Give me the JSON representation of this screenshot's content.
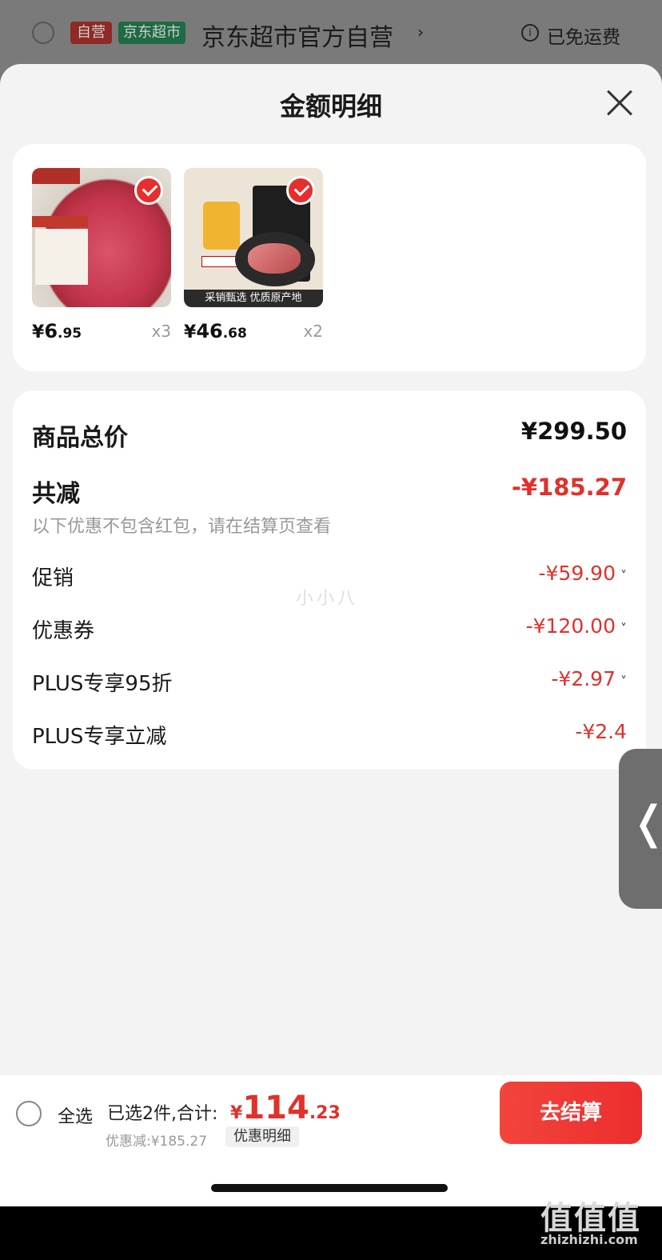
{
  "store": {
    "tag_self": "自营",
    "tag_market": "京东超市",
    "name": "京东超市官方自营",
    "chevron": "›",
    "info_icon_glyph": "i",
    "free_shipping": "已免运费"
  },
  "sheet": {
    "title": "金额明细",
    "close_icon": "close-icon"
  },
  "products": [
    {
      "yen": "¥",
      "price_int": "6",
      "price_dec": ".95",
      "qty": "x3"
    },
    {
      "yen": "¥",
      "price_int": "46",
      "price_dec": ".68",
      "qty": "x2",
      "banner": "采销甄选  优质原产地"
    }
  ],
  "summary": {
    "total_label": "商品总价",
    "total_value": "¥299.50",
    "reduce_label": "共减",
    "reduce_value": "-¥185.27",
    "note": "以下优惠不包含红包，请在结算页查看",
    "watermark": "小小八",
    "items": [
      {
        "label": "促销",
        "value": "-¥59.90",
        "expand": "˅"
      },
      {
        "label": "优惠券",
        "value": "-¥120.00",
        "expand": "˅"
      },
      {
        "label": "PLUS专享95折",
        "value": "-¥2.97",
        "expand": "˅"
      },
      {
        "label": "PLUS专享立减",
        "value": "-¥2.4"
      }
    ]
  },
  "side_handle": {
    "glyph": "❬"
  },
  "bottom": {
    "select_all": "全选",
    "selected": "已选2件,合计:",
    "total_yen": "¥",
    "total_int": "114",
    "total_dec": ".23",
    "discount": "优惠减:¥185.27",
    "detail_chip": "优惠明细",
    "checkout": "去结算"
  },
  "site": {
    "logo": "值值值",
    "url": "zhizhizhi.com"
  },
  "colors": {
    "accent_red": "#e0312b",
    "checkout_red": "#ec2e2e"
  }
}
